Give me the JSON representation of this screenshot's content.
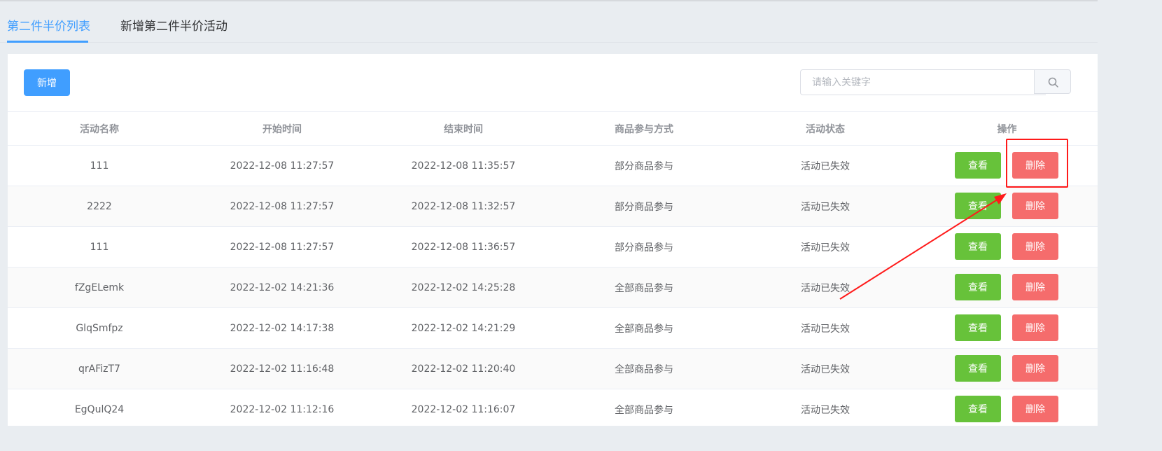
{
  "tabs": [
    {
      "label": "第二件半价列表",
      "active": true
    },
    {
      "label": "新增第二件半价活动",
      "active": false
    }
  ],
  "toolbar": {
    "add_label": "新增"
  },
  "search": {
    "placeholder": "请输入关键字",
    "value": ""
  },
  "table": {
    "headers": [
      "活动名称",
      "开始时间",
      "结束时间",
      "商品参与方式",
      "活动状态",
      "操作"
    ],
    "rows": [
      {
        "name": "111",
        "start": "2022-12-08 11:27:57",
        "end": "2022-12-08 11:35:57",
        "mode": "部分商品参与",
        "status": "活动已失效"
      },
      {
        "name": "2222",
        "start": "2022-12-08 11:27:57",
        "end": "2022-12-08 11:32:57",
        "mode": "部分商品参与",
        "status": "活动已失效"
      },
      {
        "name": "111",
        "start": "2022-12-08 11:27:57",
        "end": "2022-12-08 11:36:57",
        "mode": "部分商品参与",
        "status": "活动已失效"
      },
      {
        "name": "fZgELemk",
        "start": "2022-12-02 14:21:36",
        "end": "2022-12-02 14:25:28",
        "mode": "全部商品参与",
        "status": "活动已失效"
      },
      {
        "name": "GlqSmfpz",
        "start": "2022-12-02 14:17:38",
        "end": "2022-12-02 14:21:29",
        "mode": "全部商品参与",
        "status": "活动已失效"
      },
      {
        "name": "qrAFizT7",
        "start": "2022-12-02 11:16:48",
        "end": "2022-12-02 11:20:40",
        "mode": "全部商品参与",
        "status": "活动已失效"
      },
      {
        "name": "EgQulQ24",
        "start": "2022-12-02 11:12:16",
        "end": "2022-12-02 11:16:07",
        "mode": "全部商品参与",
        "status": "活动已失效"
      }
    ],
    "view_label": "查看",
    "delete_label": "删除"
  },
  "colors": {
    "primary": "#409eff",
    "success": "#67c23a",
    "danger": "#f56c6c",
    "annotation": "#ff1a1a"
  },
  "icons": {
    "search": "search-icon"
  }
}
